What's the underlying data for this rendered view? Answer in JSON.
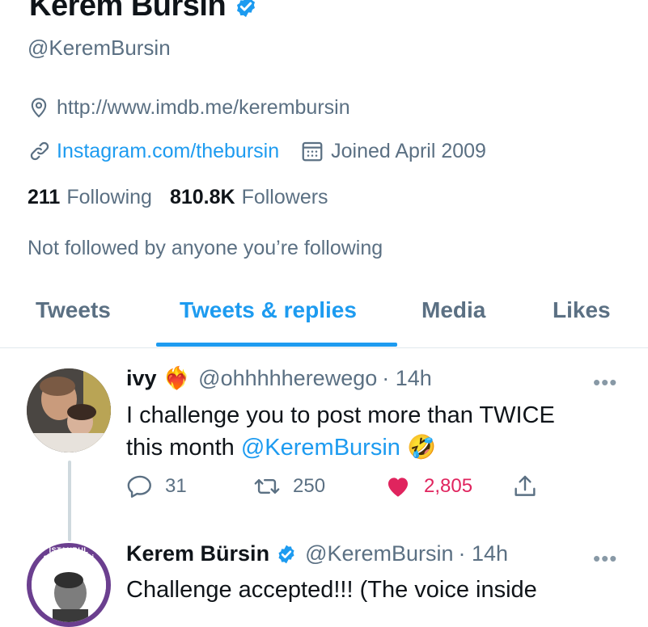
{
  "profile": {
    "display_name": "Kerem Bürsin",
    "handle": "@KeremBursin",
    "location": "http://www.imdb.me/kerembursin",
    "website": "Instagram.com/thebursin",
    "joined": "Joined April 2009",
    "following_count": "211",
    "following_label": "Following",
    "followers_count": "810.8K",
    "followers_label": "Followers",
    "not_followed_text": "Not followed by anyone you’re following"
  },
  "tabs": [
    {
      "label": "Tweets",
      "active": false
    },
    {
      "label": "Tweets & replies",
      "active": true
    },
    {
      "label": "Media",
      "active": false
    },
    {
      "label": "Likes",
      "active": false
    }
  ],
  "tweets": [
    {
      "author": "ivy",
      "emoji": "❤️‍🔥",
      "handle": "@ohhhhherewego",
      "time": "· 14h",
      "text_line1": "I challenge you to post more than TWICE",
      "text_line2_prefix": "this month ",
      "mention": "@KeremBursin",
      "text_emoji": "🤣",
      "replies": "31",
      "retweets": "250",
      "likes": "2,805",
      "more": "•••"
    },
    {
      "author": "Kerem Bürsin",
      "handle": "@KeremBursin",
      "time": "· 14h",
      "text_line1": "Challenge accepted!!! (The voice inside",
      "more": "•••",
      "avatar_ring_text": "İSTANBUL SÖZLEŞMESİ YAŞATIR"
    }
  ],
  "colors": {
    "accent": "#1d9bf0",
    "like": "#e0245e",
    "secondary_text": "#5b7083"
  }
}
